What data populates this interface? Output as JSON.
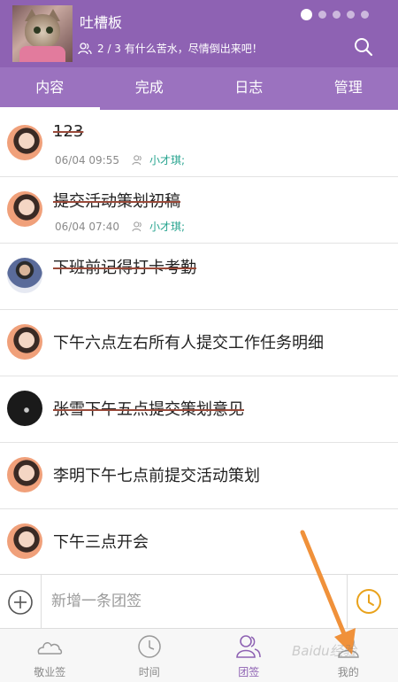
{
  "header": {
    "title": "吐槽板",
    "subtitle": "2 / 3 有什么苦水，尽情倒出来吧！",
    "search_icon": "search-icon",
    "people_icon": "people-icon"
  },
  "tabs": [
    {
      "label": "内容",
      "active": true
    },
    {
      "label": "完成"
    },
    {
      "label": "日志"
    },
    {
      "label": "管理"
    }
  ],
  "items": [
    {
      "text": "123",
      "done": true,
      "time": "06/04 09:55",
      "user": "小才琪;"
    },
    {
      "text": "提交活动策划初稿",
      "done": true,
      "time": "06/04 07:40",
      "user": "小才琪;"
    },
    {
      "text": "下班前记得打卡考勤",
      "done": true
    },
    {
      "text": "下午六点左右所有人提交工作任务明细",
      "done": false
    },
    {
      "text": "张雪下午五点提交策划意见",
      "done": true
    },
    {
      "text": "李明下午七点前提交活动策划",
      "done": false
    },
    {
      "text": "下午三点开会",
      "done": false
    }
  ],
  "add_bar": {
    "placeholder": "新增一条团签"
  },
  "bottom_nav": [
    {
      "label": "敬业签",
      "icon": "cloud-icon"
    },
    {
      "label": "时间",
      "icon": "clock-icon"
    },
    {
      "label": "团签",
      "icon": "team-icon",
      "active": true
    },
    {
      "label": "我的",
      "icon": "user-icon"
    }
  ],
  "watermark": "Baidu经验",
  "colors": {
    "header": "#8e62b3",
    "tabs": "#9b72bf",
    "accent_green": "#27a48f",
    "clock_orange": "#e9a21b",
    "arrow_orange": "#f0913a"
  }
}
